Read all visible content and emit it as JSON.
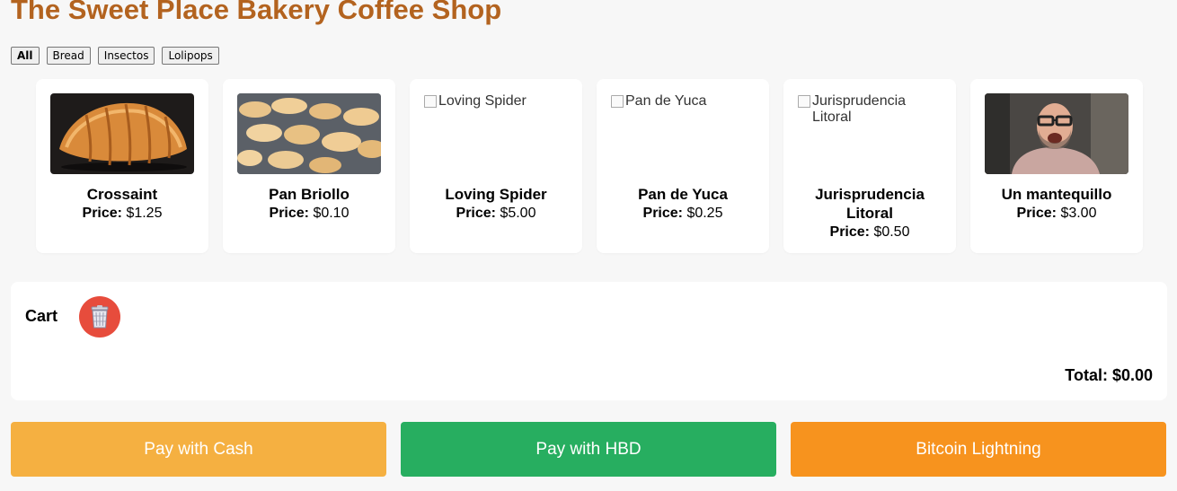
{
  "header": {
    "title": "The Sweet Place Bakery Coffee Shop"
  },
  "filters": [
    "All",
    "Bread",
    "Insectos",
    "Lolipops"
  ],
  "products": [
    {
      "name": "Crossaint",
      "price_label": "Price:",
      "price": "$1.25",
      "image": "croissant-photo"
    },
    {
      "name": "Pan Briollo",
      "price_label": "Price:",
      "price": "$0.10",
      "image": "bread-rolls-photo"
    },
    {
      "name": "Loving Spider",
      "price_label": "Price:",
      "price": "$5.00",
      "alt": "Loving Spider"
    },
    {
      "name": "Pan de Yuca",
      "price_label": "Price:",
      "price": "$0.25",
      "alt": "Pan de Yuca"
    },
    {
      "name": "Jurisprudencia Litoral",
      "price_label": "Price:",
      "price": "$0.50",
      "alt": "Jurisprudencia Litoral"
    },
    {
      "name": "Un mantequillo",
      "price_label": "Price:",
      "price": "$3.00",
      "image": "man-with-glasses-photo"
    }
  ],
  "cart": {
    "title": "Cart",
    "clear_icon": "trash-icon",
    "total": "Total: $0.00"
  },
  "payments": {
    "cash": "Pay with Cash",
    "hbd": "Pay with HBD",
    "lightning": "Bitcoin Lightning"
  },
  "colors": {
    "title": "#b3631f",
    "cash": "#f5b041",
    "hbd": "#27ae60",
    "lightning": "#f7931e",
    "trash": "#e74c3c"
  }
}
